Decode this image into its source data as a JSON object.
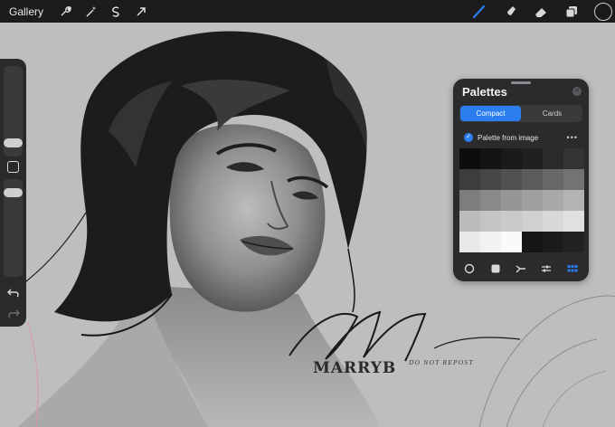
{
  "topbar": {
    "gallery_label": "Gallery",
    "left_tools": [
      "wrench-icon",
      "magic-wand-icon",
      "selection-icon",
      "transform-arrow-icon"
    ],
    "right_tools": [
      "brush-icon",
      "smudge-icon",
      "eraser-icon",
      "layers-icon"
    ],
    "active_tool": "brush-icon",
    "color_well": "#1a1a1a",
    "accent": "#2a7ef0"
  },
  "sidebar": {
    "brush_size_level": 0.3,
    "opacity_level": 0.15
  },
  "palettes": {
    "title": "Palettes",
    "tabs": [
      {
        "label": "Compact",
        "active": true
      },
      {
        "label": "Cards",
        "active": false
      }
    ],
    "palette_name": "Palette from image",
    "more_label": "•••",
    "swatches": [
      "#0d0d0d",
      "#141414",
      "#1a1a1a",
      "#202020",
      "#2a2a2a",
      "#333333",
      "#3d3d3d",
      "#474747",
      "#515151",
      "#5c5c5c",
      "#686868",
      "#737373",
      "#7d7d7d",
      "#8a8a8a",
      "#969696",
      "#9f9f9f",
      "#a9a9a9",
      "#b3b3b3",
      "#bcbcbc",
      "#c4c4c4",
      "#cacaca",
      "#d0d0d0",
      "#d8d8d8",
      "#e0e0e0",
      "#e9e9e9",
      "#f2f2f2",
      "#fafafa",
      "#161616",
      "#1b1b1b",
      "#222222"
    ],
    "bottom_icons": [
      "disc-icon",
      "classic-icon",
      "harmony-icon",
      "value-sliders-icon",
      "palettes-grid-icon"
    ],
    "active_bottom": "palettes-grid-icon"
  },
  "signature": {
    "name": "MARRYB",
    "note": "DO NOT REPOST"
  }
}
